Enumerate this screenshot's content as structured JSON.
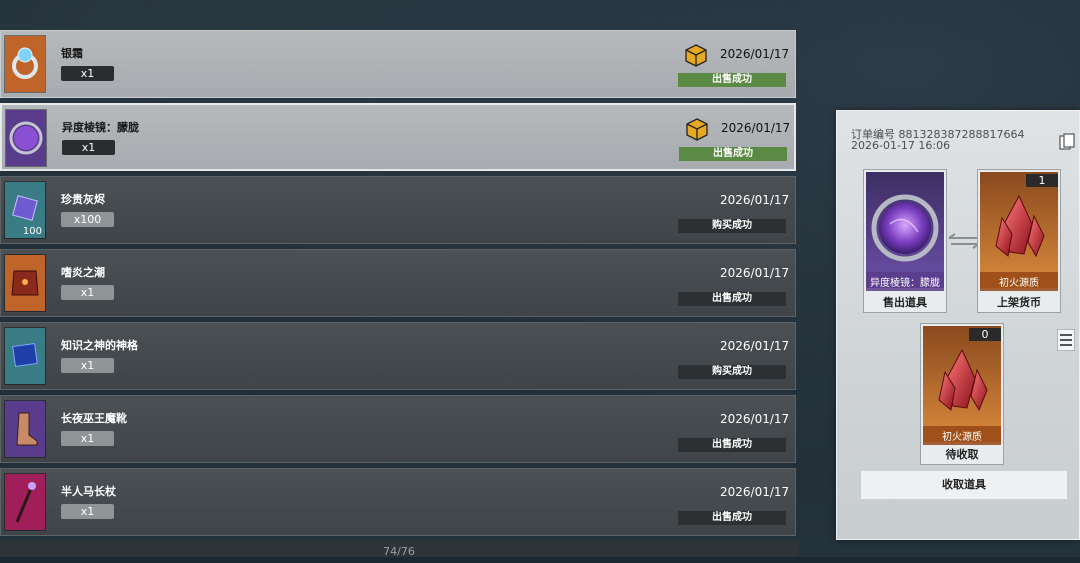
{
  "list": {
    "rows": [
      {
        "name": "银霜",
        "qty": "x1",
        "date": "2026/01/17",
        "status": "出售成功",
        "status_color": "#5a8a44",
        "theme": "light",
        "selected": false,
        "icon": "silverfrost-ring-icon",
        "count": ""
      },
      {
        "name": "异度棱镜：朦胧",
        "qty": "x1",
        "date": "2026/01/17",
        "status": "出售成功",
        "status_color": "#5a8a44",
        "theme": "light",
        "selected": true,
        "icon": "purple-prism-orb-icon",
        "count": ""
      },
      {
        "name": "珍贵灰烬",
        "qty": "x100",
        "date": "2026/01/17",
        "status": "购买成功",
        "status_color": "#2c3033",
        "theme": "dark",
        "selected": false,
        "icon": "precious-ash-cube-icon",
        "count": "100"
      },
      {
        "name": "嗜炎之潮",
        "qty": "x1",
        "date": "2026/01/17",
        "status": "出售成功",
        "status_color": "#2c3033",
        "theme": "dark",
        "selected": false,
        "icon": "flame-armor-icon",
        "count": ""
      },
      {
        "name": "知识之神的神格",
        "qty": "x1",
        "date": "2026/01/17",
        "status": "购买成功",
        "status_color": "#2c3033",
        "theme": "dark",
        "selected": false,
        "icon": "divinity-tablet-icon",
        "count": ""
      },
      {
        "name": "长夜巫王魔靴",
        "qty": "x1",
        "date": "2026/01/17",
        "status": "出售成功",
        "status_color": "#2c3033",
        "theme": "dark",
        "selected": false,
        "icon": "boots-icon",
        "count": ""
      },
      {
        "name": "半人马长杖",
        "qty": "x1",
        "date": "2026/01/17",
        "status": "出售成功",
        "status_color": "#2c3033",
        "theme": "dark",
        "selected": false,
        "icon": "staff-icon",
        "count": ""
      }
    ],
    "pager": "74/76"
  },
  "panel": {
    "order_label": "订单编号 881328387288817664",
    "order_time": "2026-01-17 16:06",
    "sold_item": {
      "art_label": "异度棱镜：朦胧",
      "caption": "售出道具"
    },
    "currency": {
      "art_label": "初火源质",
      "caption": "上架货币",
      "count": "1"
    },
    "pending": {
      "art_label": "初火源质",
      "caption": "待收取",
      "count": "0"
    },
    "collect_button": "收取道具"
  },
  "colors": {
    "success_green": "#5a8a44",
    "rarity_orange": "#c0652a",
    "rarity_purple": "#5a3c8c"
  }
}
